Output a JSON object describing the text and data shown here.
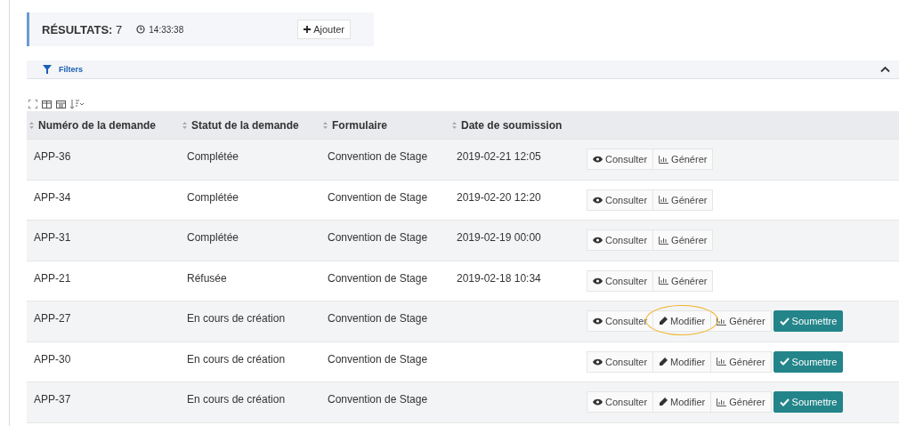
{
  "results": {
    "label": "RÉSULTATS:",
    "count": "7",
    "time": "14:33:38",
    "add_button": "Ajouter"
  },
  "filters": {
    "label": "Filters",
    "expanded": true
  },
  "table": {
    "columns": [
      "Numéro de la demande",
      "Statut de la demande",
      "Formulaire",
      "Date de soumission"
    ],
    "rows": [
      {
        "cells": [
          "APP-36",
          "Complétée",
          "Convention de Stage",
          "2019-02-21 12:05"
        ],
        "actions": [
          {
            "kind": "view",
            "label": "Consulter",
            "circled": false
          },
          {
            "kind": "generate",
            "label": "Générer",
            "circled": false
          }
        ]
      },
      {
        "cells": [
          "APP-34",
          "Complétée",
          "Convention de Stage",
          "2019-02-20 12:20"
        ],
        "actions": [
          {
            "kind": "view",
            "label": "Consulter",
            "circled": false
          },
          {
            "kind": "generate",
            "label": "Générer",
            "circled": false
          }
        ]
      },
      {
        "cells": [
          "APP-31",
          "Complétée",
          "Convention de Stage",
          "2019-02-19 00:00"
        ],
        "actions": [
          {
            "kind": "view",
            "label": "Consulter",
            "circled": false
          },
          {
            "kind": "generate",
            "label": "Générer",
            "circled": false
          }
        ]
      },
      {
        "cells": [
          "APP-21",
          "Réfusée",
          "Convention de Stage",
          "2019-02-18 10:34"
        ],
        "actions": [
          {
            "kind": "view",
            "label": "Consulter",
            "circled": false
          },
          {
            "kind": "generate",
            "label": "Générer",
            "circled": false
          }
        ]
      },
      {
        "cells": [
          "APP-27",
          "En cours de création",
          "Convention de Stage",
          ""
        ],
        "actions": [
          {
            "kind": "view",
            "label": "Consulter",
            "circled": false
          },
          {
            "kind": "edit",
            "label": "Modifier",
            "circled": true
          },
          {
            "kind": "generate",
            "label": "Générer",
            "circled": false
          },
          {
            "kind": "submit",
            "label": "Soumettre",
            "circled": false
          }
        ]
      },
      {
        "cells": [
          "APP-30",
          "En cours de création",
          "Convention de Stage",
          ""
        ],
        "actions": [
          {
            "kind": "view",
            "label": "Consulter",
            "circled": false
          },
          {
            "kind": "edit",
            "label": "Modifier",
            "circled": false
          },
          {
            "kind": "generate",
            "label": "Générer",
            "circled": false
          },
          {
            "kind": "submit",
            "label": "Soumettre",
            "circled": false
          }
        ]
      },
      {
        "cells": [
          "APP-37",
          "En cours de création",
          "Convention de Stage",
          ""
        ],
        "actions": [
          {
            "kind": "view",
            "label": "Consulter",
            "circled": false
          },
          {
            "kind": "edit",
            "label": "Modifier",
            "circled": false
          },
          {
            "kind": "generate",
            "label": "Générer",
            "circled": false
          },
          {
            "kind": "submit",
            "label": "Soumettre",
            "circled": false
          }
        ]
      }
    ]
  }
}
